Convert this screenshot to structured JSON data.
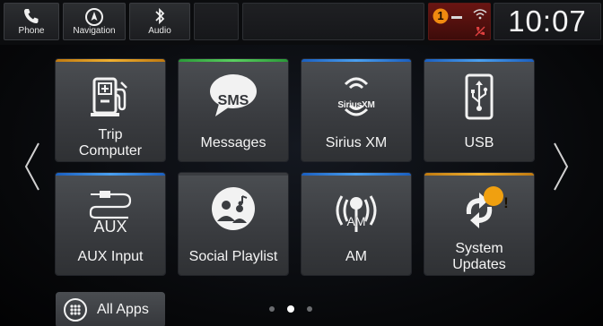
{
  "topbar": {
    "phone_label": "Phone",
    "navigation_label": "Navigation",
    "audio_label": "Audio",
    "notification_count": "1",
    "clock": "10:07"
  },
  "tiles": [
    {
      "label_line1": "Trip",
      "label_line2": "Computer",
      "icon": "fuel-pump-icon",
      "accent": "#e0a020"
    },
    {
      "label_line1": "Messages",
      "label_line2": "",
      "icon": "sms-bubble-icon",
      "icon_text": "SMS",
      "accent": "#3cbf4a"
    },
    {
      "label_line1": "Sirius XM",
      "label_line2": "",
      "icon": "siriusxm-icon",
      "icon_text": "SiriusXM",
      "accent": "#2a7be0"
    },
    {
      "label_line1": "USB",
      "label_line2": "",
      "icon": "usb-icon",
      "accent": "#2a7be0"
    },
    {
      "label_line1": "AUX Input",
      "label_line2": "",
      "icon": "aux-cable-icon",
      "icon_text": "AUX",
      "accent": "#2a7be0"
    },
    {
      "label_line1": "Social Playlist",
      "label_line2": "",
      "icon": "people-music-icon",
      "accent": "#3a3c40"
    },
    {
      "label_line1": "AM",
      "label_line2": "",
      "icon": "am-antenna-icon",
      "icon_text": "AM",
      "accent": "#2a7be0"
    },
    {
      "label_line1": "System",
      "label_line2": "Updates",
      "icon": "sync-update-icon",
      "badge": "!",
      "accent": "#e0a020"
    }
  ],
  "bottom": {
    "all_apps_label": "All Apps",
    "page_count": 3,
    "active_page": 2
  }
}
